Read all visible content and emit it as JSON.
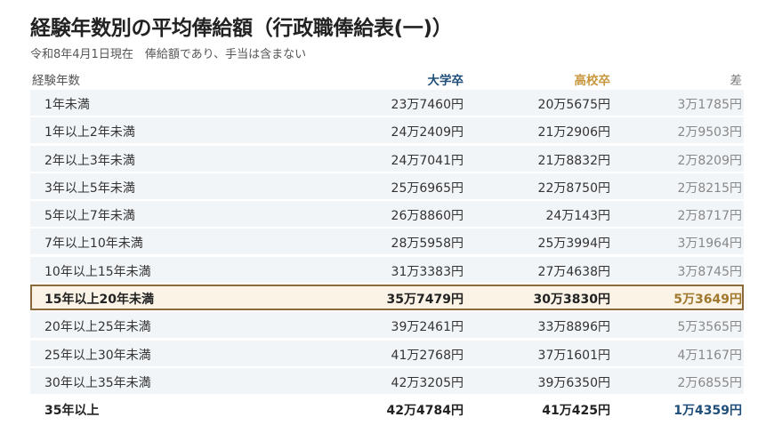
{
  "title": "経験年数別の平均俸給額（行政職俸給表(一)）",
  "subtitle": "令和8年4月1日現在　俸給額であり、手当は含まない",
  "colors": {
    "university": "#1f4e79",
    "highschool": "#c8963c",
    "highlight_border": "#8a6a3a",
    "highlight_bg": "#faf3e6",
    "row_bg": "#f2f5f8"
  },
  "chart_data": {
    "type": "table",
    "title": "経験年数別の平均俸給額（行政職俸給表(一)）",
    "subtitle": "令和8年4月1日現在　俸給額であり、手当は含まない",
    "columns": [
      "経験年数",
      "大学卒",
      "高校卒",
      "差"
    ],
    "rows": [
      {
        "years": "1年未満",
        "university": "23万7460円",
        "highschool": "20万5675円",
        "diff": "3万1785円"
      },
      {
        "years": "1年以上2年未満",
        "university": "24万2409円",
        "highschool": "21万2906円",
        "diff": "2万9503円"
      },
      {
        "years": "2年以上3年未満",
        "university": "24万7041円",
        "highschool": "21万8832円",
        "diff": "2万8209円"
      },
      {
        "years": "3年以上5年未満",
        "university": "25万6965円",
        "highschool": "22万8750円",
        "diff": "2万8215円"
      },
      {
        "years": "5年以上7年未満",
        "university": "26万8860円",
        "highschool": "24万143円",
        "diff": "2万8717円"
      },
      {
        "years": "7年以上10年未満",
        "university": "28万5958円",
        "highschool": "25万3994円",
        "diff": "3万1964円"
      },
      {
        "years": "10年以上15年未満",
        "university": "31万3383円",
        "highschool": "27万4638円",
        "diff": "3万8745円"
      },
      {
        "years": "15年以上20年未満",
        "university": "35万7479円",
        "highschool": "30万3830円",
        "diff": "5万3649円"
      },
      {
        "years": "20年以上25年未満",
        "university": "39万2461円",
        "highschool": "33万8896円",
        "diff": "5万3565円"
      },
      {
        "years": "25年以上30年未満",
        "university": "41万2768円",
        "highschool": "37万1601円",
        "diff": "4万1167円"
      },
      {
        "years": "30年以上35年未満",
        "university": "42万3205円",
        "highschool": "39万6350円",
        "diff": "2万6855円"
      },
      {
        "years": "35年以上",
        "university": "42万4784円",
        "highschool": "41万425円",
        "diff": "1万4359円"
      }
    ],
    "highlighted_row": 7,
    "bold_last_row": true
  }
}
